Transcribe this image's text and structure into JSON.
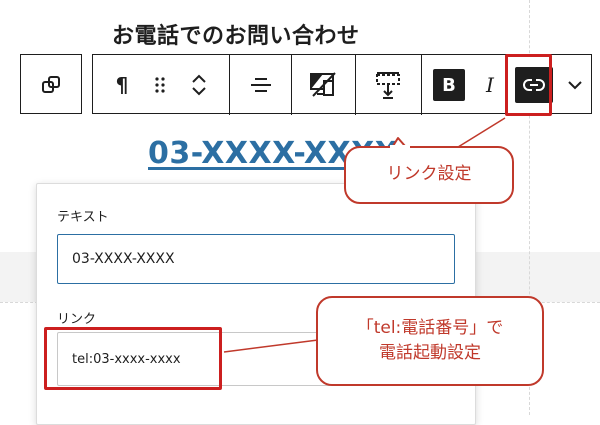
{
  "heading": "お電話でのお問い合わせ",
  "toolbar": {
    "paragraph_glyph": "¶",
    "bold_label": "B",
    "italic_label": "I"
  },
  "phone_link_text": "03-XXXX-XXXX",
  "link_popover": {
    "text_label": "テキスト",
    "text_value": "03-XXXX-XXXX",
    "link_label": "リンク",
    "link_value": "tel:03-xxxx-xxxx"
  },
  "callouts": {
    "link_setting": "リンク設定",
    "tel_line1": "「tel:電話番号」で",
    "tel_line2": "電話起動設定"
  },
  "colors": {
    "accent_link": "#2c6fa3",
    "highlight_red": "#cc1f1f",
    "toolbar_dark": "#1e1e1e"
  }
}
